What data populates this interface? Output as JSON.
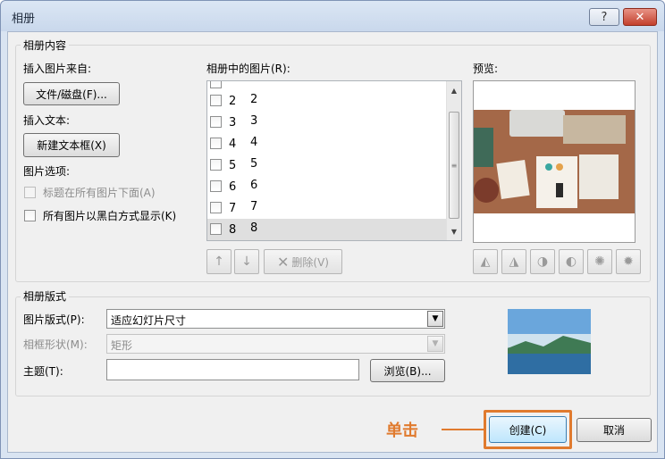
{
  "window": {
    "title": "相册",
    "help_label": "?",
    "close_label": "✕"
  },
  "content_group": {
    "title": "相册内容",
    "insert_from_label": "插入图片来自:",
    "file_disk_button": "文件/磁盘(F)...",
    "insert_text_label": "插入文本:",
    "new_textbox_button": "新建文本框(X)",
    "picture_options_label": "图片选项:",
    "caption_below_all": "标题在所有图片下面(A)",
    "all_black_white": "所有图片以黑白方式显示(K)"
  },
  "pictures_list": {
    "label": "相册中的图片(R):",
    "items": [
      {
        "num": "2",
        "name": "2"
      },
      {
        "num": "3",
        "name": "3"
      },
      {
        "num": "4",
        "name": "4"
      },
      {
        "num": "5",
        "name": "5"
      },
      {
        "num": "6",
        "name": "6"
      },
      {
        "num": "7",
        "name": "7"
      },
      {
        "num": "8",
        "name": "8"
      }
    ],
    "selected_index": 6,
    "move_up_icon": "arrow-up-icon",
    "move_down_icon": "arrow-down-icon",
    "delete_label": "删除(V)"
  },
  "preview": {
    "label": "预览:"
  },
  "layout_group": {
    "title": "相册版式",
    "picture_layout_label": "图片版式(P):",
    "picture_layout_value": "适应幻灯片尺寸",
    "frame_shape_label": "相框形状(M):",
    "frame_shape_value": "矩形",
    "theme_label": "主题(T):",
    "theme_value": "",
    "browse_button": "浏览(B)..."
  },
  "footer": {
    "annotation": "单击",
    "create_button": "创建(C)",
    "cancel_button": "取消"
  },
  "colors": {
    "annotation": "#e07a2e",
    "window_frame": "#d9e4f2"
  }
}
